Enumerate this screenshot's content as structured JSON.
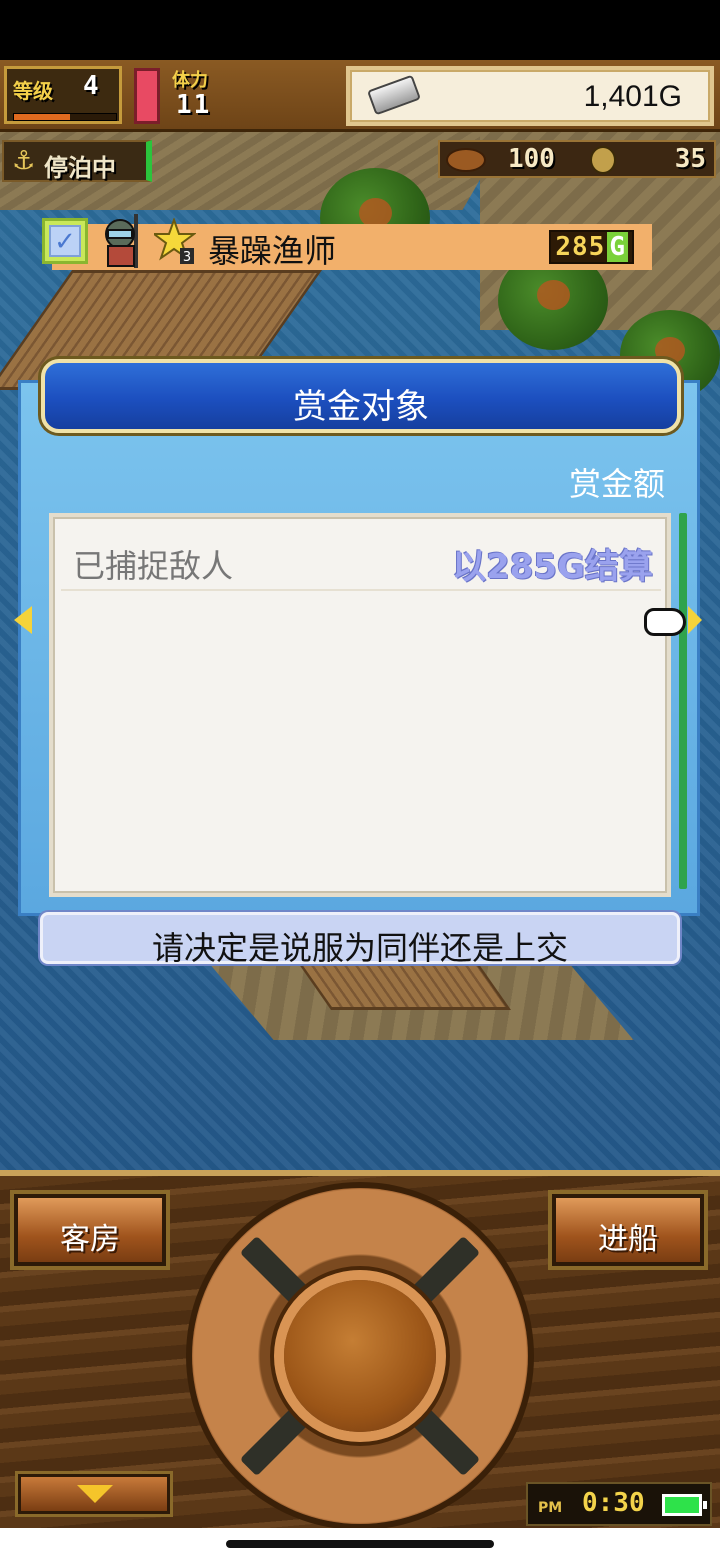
{
  "hud": {
    "level_label": "等级",
    "level_value": "4",
    "exp_fraction": 0.55,
    "stamina_label": "体力",
    "stamina_value": "11",
    "stamina_fraction": 1.0,
    "gold_value": "1,401G",
    "docked_label": "停泊中",
    "food_value": "100",
    "wood_value": "35",
    "icons": {
      "gold": "silver-bar-icon",
      "food": "food-icon",
      "wood": "coin-icon",
      "anchor": "anchor-icon"
    }
  },
  "dialog": {
    "title": "赏金对象",
    "bounty_column": "赏金额",
    "list_header_label": "已捕捉敌人",
    "list_header_total": "以285G结算",
    "rows": [
      {
        "name": "暴躁渔师",
        "bounty_number": "285",
        "bounty_unit": "G",
        "rank": "3",
        "checked": true
      }
    ],
    "instruction": "请决定是说服为同伴还是上交"
  },
  "console": {
    "left_button": "客房",
    "right_button": "进船",
    "ampm": "PM",
    "clock": "0:30",
    "battery_fraction": 1.0
  },
  "colors": {
    "dialog_bg": "#5ba8e0",
    "header_bg": "#1c4fbf",
    "row_highlight": "#f2b06b",
    "total_text": "#9aa2ee"
  }
}
